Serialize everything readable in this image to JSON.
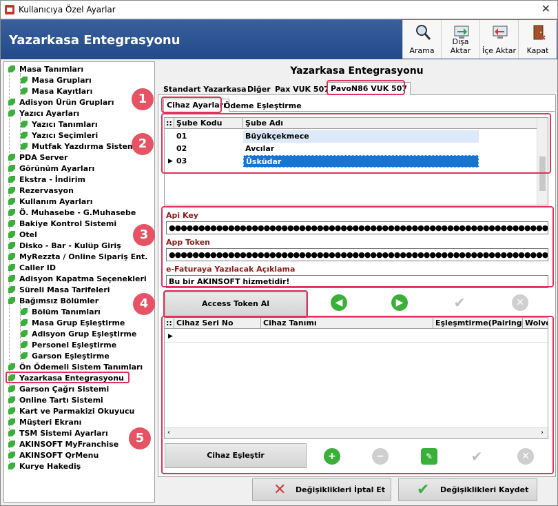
{
  "window": {
    "title": "Kullanıcıya Özel Ayarlar",
    "close_label": "✕"
  },
  "header": {
    "title": "Yazarkasa Entegrasyonu"
  },
  "toolbar": [
    {
      "label": "Arama",
      "icon": "magnifier-icon"
    },
    {
      "label": "Dışa Aktar",
      "icon": "export-icon"
    },
    {
      "label": "İçe Aktar",
      "icon": "import-icon"
    },
    {
      "label": "Kapat",
      "icon": "exit-door-icon"
    }
  ],
  "tree": {
    "items": [
      "Masa Tanımları",
      "Masa Grupları",
      "Masa Kayıtları",
      "Adisyon Ürün Grupları",
      "Yazıcı Ayarları",
      "Yazıcı Tanımları",
      "Yazıcı Seçimleri",
      "Mutfak Yazdırma Sistemi",
      "PDA Server",
      "Görünüm Ayarları",
      "Ekstra - İndirim",
      "Rezervasyon",
      "Kullanım Ayarları",
      "Ö. Muhasebe - G.Muhasebe",
      "Bakiye Kontrol Sistemi",
      "Otel",
      "Disko - Bar - Kulüp Giriş",
      "MyRezzta / Online Sipariş Ent.",
      "Caller ID",
      "Adisyon Kapatma Seçenekleri",
      "Süreli Masa Tarifeleri",
      "Bağımsız Bölümler",
      "Bölüm Tanımları",
      "Masa Grup Eşleştirme",
      "Adisyon Grup Eşleştirme",
      "Personel Eşleştirme",
      "Garson Eşleştirme",
      "Ön Ödemeli Sistem Tanımları",
      "Yazarkasa Entegrasyonu",
      "Garson Çağrı Sistemi",
      "Online Tartı Sistemi",
      "Kart ve Parmakizi Okuyucu",
      "Müşteri Ekranı",
      "TSM Sistemi Ayarları",
      "AKINSOFT MyFranchise",
      "AKINSOFT QrMenu",
      "Kurye Hakediş"
    ],
    "selected": "Yazarkasa Entegrasyonu"
  },
  "main": {
    "title": "Yazarkasa Entegrasyonu",
    "tabs": [
      "Standart Yazarkasa",
      "Diğer",
      "Pax VUK 507",
      "PavoN86 VUK 507"
    ],
    "active_tab": "PavoN86 VUK 507",
    "subtabs": [
      "Cihaz Ayarları",
      "Ödeme Eşleştirme"
    ],
    "active_subtab": "Cihaz Ayarları"
  },
  "branch_grid": {
    "grip": "::",
    "columns": [
      "Şube Kodu",
      "Şube Adı"
    ],
    "rows": [
      {
        "code": "01",
        "name": "Büyükçekmece"
      },
      {
        "code": "02",
        "name": "Avcılar"
      },
      {
        "code": "03",
        "name": "Üsküdar"
      }
    ],
    "selected_row": "03"
  },
  "fields": {
    "api_key_label": "Api Key",
    "api_key_value": "●●●●●●●●●●●●●●●●●●●●●●●●●●●●●●●●●●●●●●●●●●●●●●●●●●●●●●●●●●●●●●●●●●●●●●●●●●●●",
    "app_token_label": "App Token",
    "app_token_value": "●●●●●●●●●●●●●●●●●●●●●●●●●●●●●●●●●●●●●●●●●●●●●●●●●●●●●●●●●●●●●●●●●●●●●●●●●●●●",
    "efatura_label": "e-Faturaya Yazılacak Açıklama",
    "efatura_value": "Bu bir AKINSOFT hizmetidir!"
  },
  "buttons": {
    "access_token": "Access Token Al",
    "cihaz_eslestir": "Cihaz Eşleştir",
    "cancel": "Değişiklikleri İptal Et",
    "save": "Değişiklikleri Kaydet"
  },
  "device_grid": {
    "grip": "::",
    "columns": [
      "Cihaz Seri No",
      "Cihaz Tanımı",
      "Eşleşmtirme(Pairing...",
      "Wolvo"
    ]
  },
  "callouts": [
    "1",
    "2",
    "3",
    "4",
    "5"
  ],
  "colors": {
    "header_bg": "#214a8a",
    "highlight": "#e0325d",
    "callout": "#e55364",
    "selection": "#1874d3"
  }
}
